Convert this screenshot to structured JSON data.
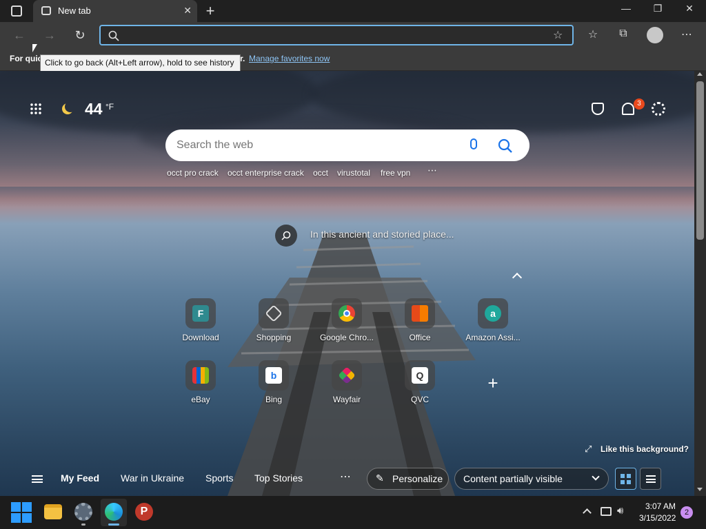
{
  "browser": {
    "tab_title": "New tab",
    "tooltip": "Click to go back (Alt+Left arrow), hold to see history",
    "address_placeholder": "",
    "favorites_prefix": "For quic",
    "favorites_suffix": "r.",
    "favorites_link": "Manage favorites now"
  },
  "weather": {
    "temperature": "44",
    "unit": "°F"
  },
  "notifications": {
    "count": "3"
  },
  "search": {
    "placeholder": "Search the web",
    "trending": [
      "occt pro crack",
      "occt enterprise crack",
      "occt",
      "virustotal",
      "free vpn"
    ]
  },
  "background": {
    "caption": "In this ancient and storied place...",
    "like_label": "Like this background?"
  },
  "quick_links": [
    {
      "label": "Download",
      "glyph": "F"
    },
    {
      "label": "Shopping",
      "glyph": ""
    },
    {
      "label": "Google Chro...",
      "glyph": ""
    },
    {
      "label": "Office",
      "glyph": ""
    },
    {
      "label": "Amazon Assi...",
      "glyph": "a"
    },
    {
      "label": "eBay",
      "glyph": ""
    },
    {
      "label": "Bing",
      "glyph": "b"
    },
    {
      "label": "Wayfair",
      "glyph": ""
    },
    {
      "label": "QVC",
      "glyph": "Q"
    }
  ],
  "feed": {
    "items": [
      "My Feed",
      "War in Ukraine",
      "Sports",
      "Top Stories"
    ],
    "personalize": "Personalize",
    "visibility": "Content partially visible"
  },
  "taskbar": {
    "time": "3:07 AM",
    "date": "3/15/2022",
    "notification_count": "2"
  },
  "colors": {
    "accent": "#6fb5e8",
    "badge": "#e8491d",
    "link": "#8ec5f5"
  }
}
